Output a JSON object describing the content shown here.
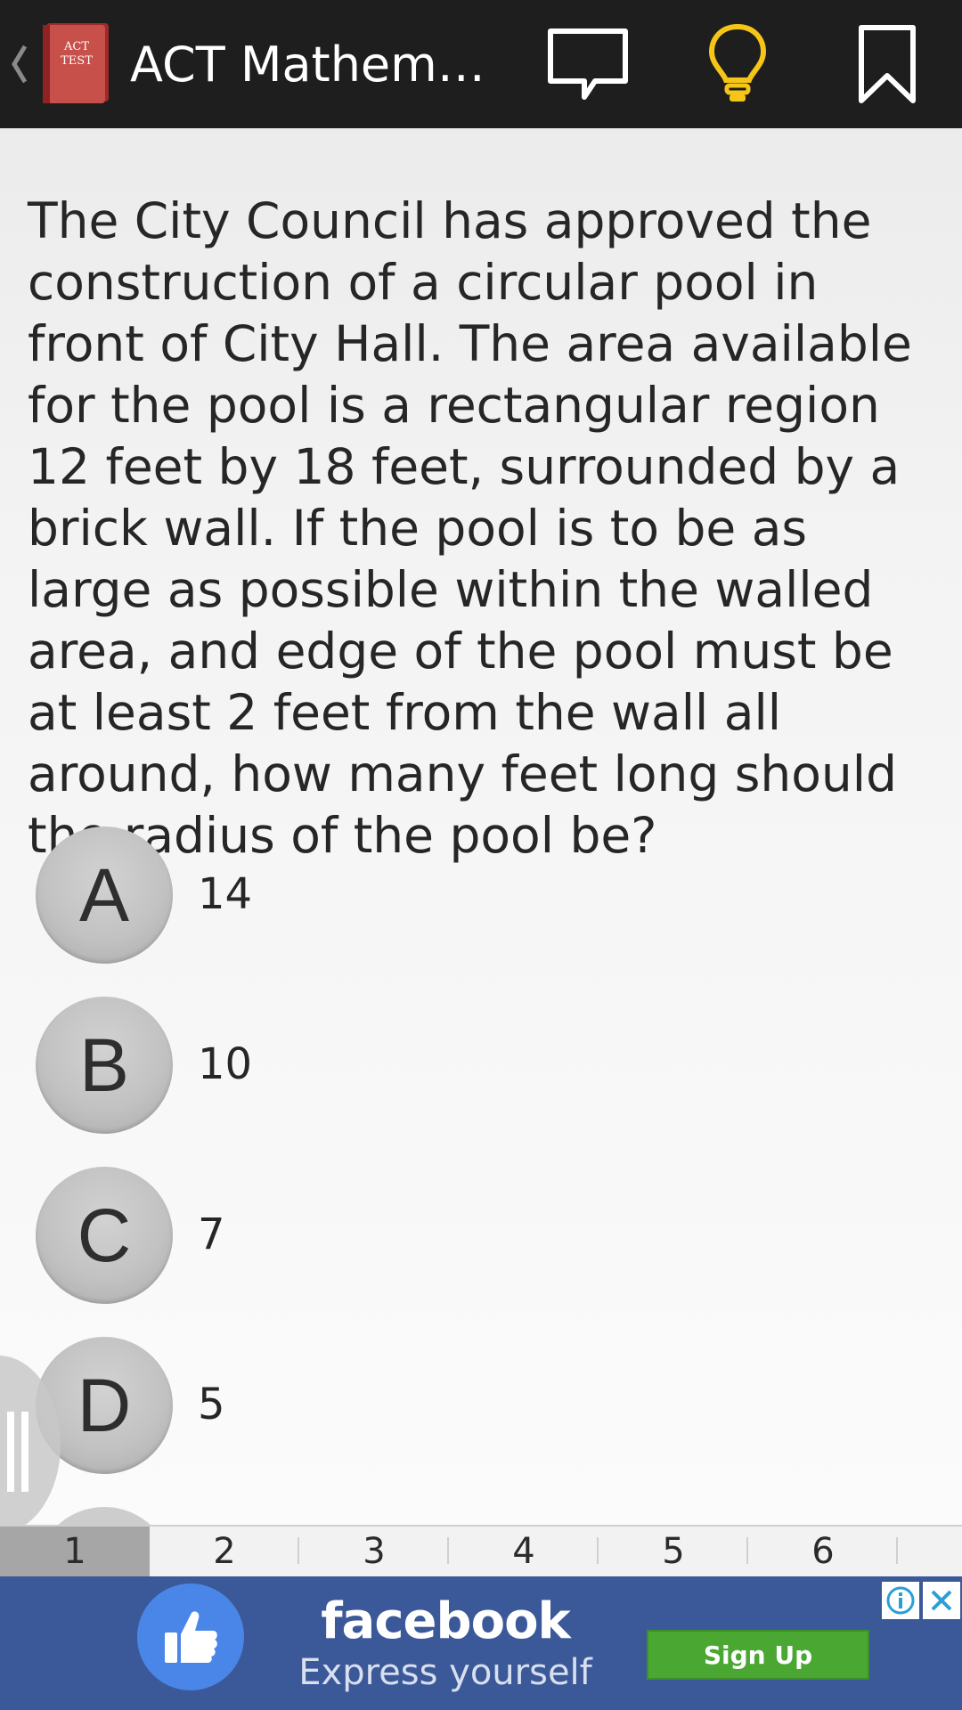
{
  "header": {
    "title": "ACT Mathemat...",
    "icon_text_top": "ACT",
    "icon_text_bottom": "TEST",
    "icons": [
      "back-caret-icon",
      "comment-icon",
      "lightbulb-icon",
      "bookmark-icon"
    ],
    "hint_color": "#f5c518"
  },
  "question": {
    "text": "The City Council has approved the construction of a circular pool in front of City Hall. The area available for the pool is a rectangular region 12 feet by 18 feet, surrounded by a brick wall. If the pool is to be as large as possible within the walled area, and edge of the pool must be at least 2 feet from the wall all around, how many feet long should the radius of the pool be?"
  },
  "options": [
    {
      "letter": "A",
      "value": "14"
    },
    {
      "letter": "B",
      "value": "10"
    },
    {
      "letter": "C",
      "value": "7"
    },
    {
      "letter": "D",
      "value": "5"
    }
  ],
  "pager": {
    "pages": [
      "1",
      "2",
      "3",
      "4",
      "5",
      "6"
    ],
    "active": "1"
  },
  "ad": {
    "brand": "facebook",
    "tagline": "Express yourself",
    "cta": "Sign Up",
    "background": "#3b5998",
    "cta_color": "#4aa832",
    "icons": [
      "thumbs-up-icon",
      "info-icon",
      "close-icon"
    ]
  }
}
